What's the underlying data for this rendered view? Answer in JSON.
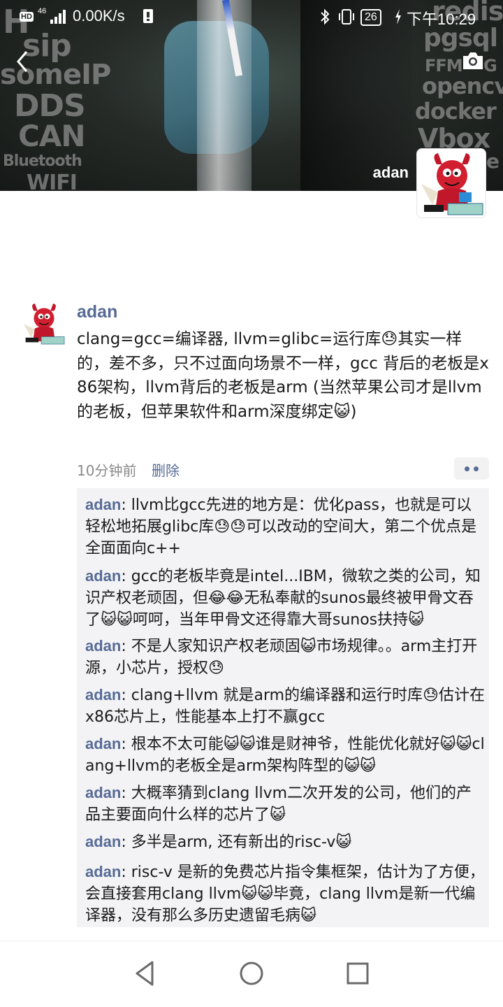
{
  "status_bar": {
    "hd": "HD",
    "network": "46",
    "speed": "0.00K/s",
    "battery": "26",
    "time": "下午10:29"
  },
  "cover": {
    "watermark_words": [
      "H",
      "sip",
      "someIP",
      "DDS",
      "CAN",
      "Bluetooth",
      "WIFI",
      "redis",
      "pgsql",
      "FFM",
      "G",
      "opencv",
      "docker",
      "Vbox",
      "e"
    ],
    "username": "adan"
  },
  "post": {
    "author": "adan",
    "text": "clang=gcc=编译器, llvm=glibc=运行库😓其实一样的，差不多，只不过面向场景不一样，gcc 背后的老板是x86架构，llvm背后的老板是arm (当然苹果公司才是llvm的老板，但苹果软件和arm深度绑定😺)",
    "time": "10分钟前",
    "delete_label": "删除"
  },
  "comments": [
    {
      "author": "adan",
      "text": "llvm比gcc先进的地方是：优化pass，也就是可以轻松地拓展glibc库😓😓可以改动的空间大，第二个优点是全面面向c++"
    },
    {
      "author": "adan",
      "text": "gcc的老板毕竟是intel...IBM，微软之类的公司，知识产权老顽固，但😂😂无私奉献的sunos最终被甲骨文吞了😺😺呵呵，当年甲骨文还得靠大哥sunos扶持😺"
    },
    {
      "author": "adan",
      "text": "不是人家知识产权老顽固😺市场规律。。arm主打开源，小芯片，授权😓"
    },
    {
      "author": "adan",
      "text": "clang+llvm 就是arm的编译器和运行时库😓估计在x86芯片上，性能基本上打不赢gcc"
    },
    {
      "author": "adan",
      "text": "根本不太可能😺😺谁是财神爷，性能优化就好😺😺clang+llvm的老板全是arm架构阵型的😺😺"
    },
    {
      "author": "adan",
      "text": "大概率猜到clang llvm二次开发的公司，他们的产品主要面向什么样的芯片了😺"
    },
    {
      "author": "adan",
      "text": "多半是arm, 还有新出的risc-v😺"
    },
    {
      "author": "adan",
      "text": "risc-v 是新的免费芯片指令集框架，估计为了方便，会直接套用clang llvm😺😺毕竟，clang llvm是新一代编译器，没有那么多历史遗留毛病😺"
    }
  ],
  "colors": {
    "link_blue": "#576b95",
    "comment_bg": "#f3f3f5",
    "meta_gray": "#8a8a8a"
  }
}
